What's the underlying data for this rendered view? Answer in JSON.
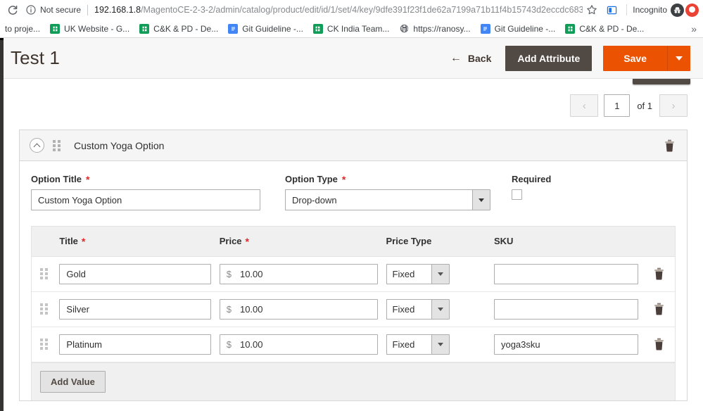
{
  "browser": {
    "reload_icon": "reload-icon",
    "security": {
      "icon": "info-circle-icon",
      "label": "Not secure"
    },
    "url": {
      "host": "192.168.1.8",
      "path": "/MagentoCE-2-3-2/admin/catalog/product/edit/id/1/set/4/key/9dfe391f23f1de62a7199a71b11f4b15743d2eccdc683..."
    },
    "star_icon": "bookmark-star-icon",
    "extension_icon": "extension-icon",
    "incognito_label": "Incognito",
    "incognito_icon": "incognito-hat-icon",
    "profile_icon": "profile-avatar-icon",
    "bookmarks": [
      {
        "label": "to proje...",
        "icon": "none"
      },
      {
        "label": "UK Website - G...",
        "icon": "sheets"
      },
      {
        "label": "C&K & PD - De...",
        "icon": "sheets"
      },
      {
        "label": "Git Guideline -...",
        "icon": "docs"
      },
      {
        "label": "CK India Team...",
        "icon": "sheets"
      },
      {
        "label": "https://ranosy...",
        "icon": "globe"
      },
      {
        "label": "Git Guideline -...",
        "icon": "docs"
      },
      {
        "label": "C&K & PD - De...",
        "icon": "sheets"
      }
    ],
    "bookmarks_overflow": "»"
  },
  "header": {
    "title": "Test 1",
    "back_label": "Back",
    "back_icon": "arrow-left-icon",
    "add_attribute_label": "Add Attribute",
    "save_label": "Save",
    "save_caret_icon": "chevron-down-icon"
  },
  "pagination": {
    "prev_icon": "chevron-left-icon",
    "next_icon": "chevron-right-icon",
    "current_page": "1",
    "of_label": "of 1"
  },
  "option": {
    "collapse_icon": "chevron-up-circle-icon",
    "drag_icon": "drag-handle-icon",
    "panel_title": "Custom Yoga Option",
    "delete_icon": "trash-icon",
    "fields": {
      "option_title": {
        "label": "Option Title",
        "required_marker": "*",
        "value": "Custom Yoga Option"
      },
      "option_type": {
        "label": "Option Type",
        "required_marker": "*",
        "value": "Drop-down",
        "caret_icon": "chevron-down-icon"
      },
      "required": {
        "label": "Required",
        "checked": false
      }
    },
    "values_table": {
      "columns": [
        {
          "label": "Title",
          "required_marker": "*"
        },
        {
          "label": "Price",
          "required_marker": "*"
        },
        {
          "label": "Price Type",
          "required_marker": ""
        },
        {
          "label": "SKU",
          "required_marker": ""
        }
      ],
      "currency_symbol": "$",
      "rows": [
        {
          "drag_icon": "drag-handle-icon",
          "title": "Gold",
          "price": "10.00",
          "price_type": "Fixed",
          "sku": "",
          "sku_placeholder": "",
          "delete_icon": "trash-icon"
        },
        {
          "drag_icon": "drag-handle-icon",
          "title": "Silver",
          "price": "10.00",
          "price_type": "Fixed",
          "sku": "",
          "sku_placeholder": "",
          "delete_icon": "trash-icon"
        },
        {
          "drag_icon": "drag-handle-icon",
          "title": "Platinum",
          "price": "10.00",
          "price_type": "Fixed",
          "sku": "yoga3sku",
          "sku_placeholder": "",
          "delete_icon": "trash-icon"
        }
      ],
      "add_value_label": "Add Value"
    }
  },
  "colors": {
    "accent_orange": "#eb5202",
    "dark_brown": "#514943",
    "required_red": "#e22626",
    "panel_gray": "#f5f5f5"
  }
}
